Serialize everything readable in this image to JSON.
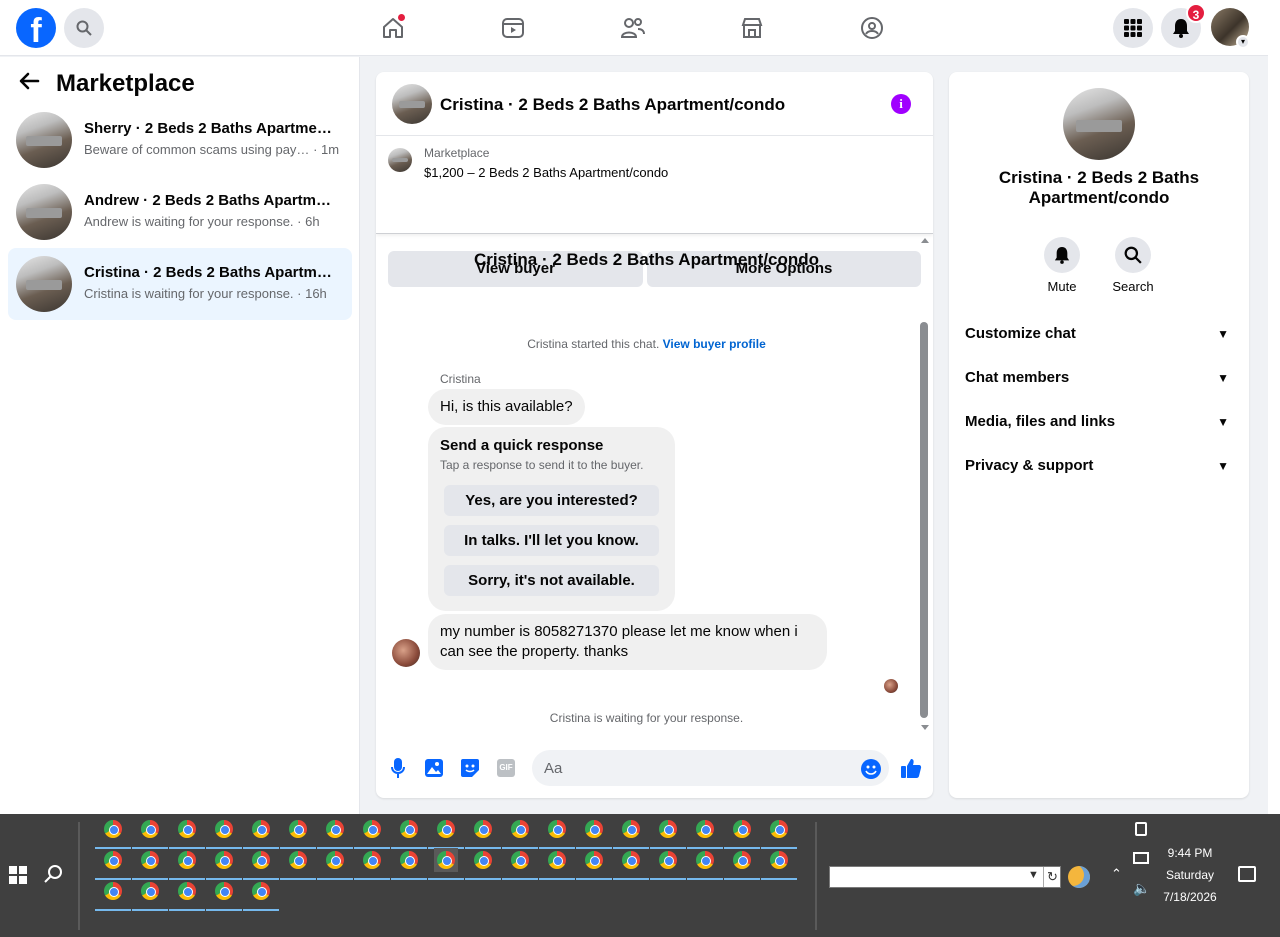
{
  "topbar": {
    "logo": "f",
    "notifications_count": "3",
    "icons": [
      "search-icon",
      "home-icon",
      "video-icon",
      "friends-icon",
      "marketplace-icon",
      "groups-icon",
      "menu-grid-icon",
      "bell-icon"
    ]
  },
  "sidebar": {
    "title": "Marketplace",
    "conversations": [
      {
        "name": "Sherry · 2 Beds 2 Baths Apartment…",
        "preview": "Beware of common scams using pay…",
        "time": "· 1m",
        "active": false
      },
      {
        "name": "Andrew · 2 Beds 2 Baths Apartme…",
        "preview": "Andrew is waiting for your response.",
        "time": "· 6h",
        "active": false
      },
      {
        "name": "Cristina · 2 Beds 2 Baths Apartmen…",
        "preview": "Cristina is waiting for your response.",
        "time": "· 16h",
        "active": true
      }
    ]
  },
  "chat": {
    "title": "Cristina · 2 Beds 2 Baths Apartment/condo",
    "info_label": "i",
    "listing_label": "Marketplace",
    "listing_price": "$1,200 – 2 Beds 2 Baths Apartment/condo",
    "view_buyer": "View buyer",
    "more_options": "More Options",
    "big_name": "Cristina · 2 Beds 2 Baths Apartment/condo",
    "started_text": "Cristina started this chat.",
    "view_profile": "View buyer profile",
    "sender": "Cristina",
    "message_1": "Hi, is this available?",
    "quick_title": "Send a quick response",
    "quick_sub": "Tap a response to send it to the buyer.",
    "quick_options": [
      "Yes, are you interested?",
      "In talks. I'll let you know.",
      "Sorry, it's not available."
    ],
    "message_2": "my number is 8058271370 please let me know when i can see the property. thanks",
    "waiting": "Cristina is waiting for your response.",
    "input_placeholder": "Aa",
    "gif_label": "GIF"
  },
  "right_panel": {
    "name": "Cristina · 2 Beds 2 Baths Apartment/condo",
    "mute": "Mute",
    "search": "Search",
    "sections": [
      "Customize chat",
      "Chat members",
      "Media, files and links",
      "Privacy & support"
    ]
  },
  "taskbar": {
    "time": "9:44 PM",
    "day": "Saturday",
    "date": "7/18/2026"
  }
}
